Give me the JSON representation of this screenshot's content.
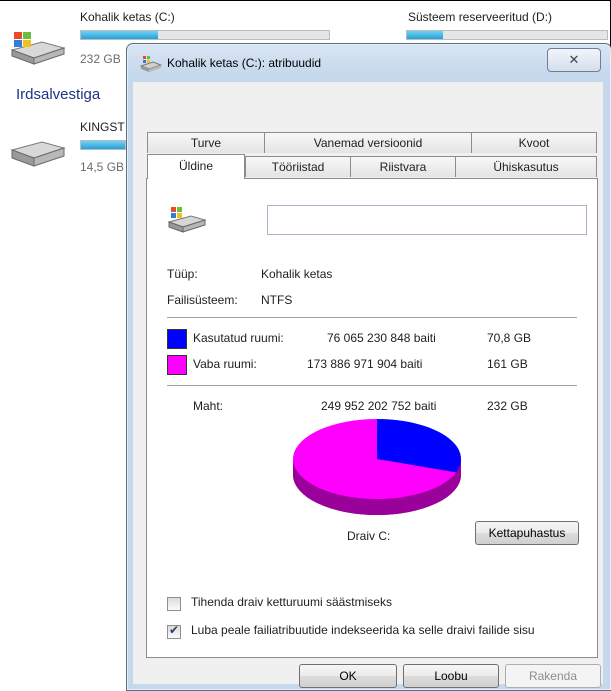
{
  "explorer": {
    "drives": [
      {
        "name": "Kohalik ketas (C:)",
        "size": "232 GB"
      },
      {
        "name": "Süsteem reserveeritud (D:)",
        "size": ""
      },
      {
        "name": "KINGST",
        "size": "14,5 GB"
      }
    ],
    "group_heading": "Irdsalvestiga"
  },
  "dialog": {
    "title": "Kohalik ketas (C:): atribuudid",
    "close_glyph": "✕",
    "tabs_row1": [
      "Turve",
      "Vanemad versioonid",
      "Kvoot"
    ],
    "tabs_row2": [
      "Üldine",
      "Tööriistad",
      "Riistvara",
      "Ühiskasutus"
    ],
    "active_tab": "Üldine",
    "drive_name_value": "",
    "type_label": "Tüüp:",
    "type_value": "Kohalik ketas",
    "fs_label": "Failisüsteem:",
    "fs_value": "NTFS",
    "used": {
      "label": "Kasutatud ruumi:",
      "bytes": "76 065 230 848 baiti",
      "size": "70,8 GB",
      "color": "#0000ff"
    },
    "free": {
      "label": "Vaba ruumi:",
      "bytes": "173 886 971 904 baiti",
      "size": "161 GB",
      "color": "#ff00ff"
    },
    "capacity": {
      "label": "Maht:",
      "bytes": "249 952 202 752 baiti",
      "size": "232 GB"
    },
    "used_fraction": 0.304,
    "drive_label": "Draiv C:",
    "cleanup_button": "Kettapuhastus",
    "compress_label": "Tihenda draiv ketturuumi säästmiseks",
    "compress_checked": false,
    "index_label": "Luba peale failiatribuutide indekseerida ka selle draivi failide sisu",
    "index_checked": true,
    "ok_button": "OK",
    "cancel_button": "Loobu",
    "apply_button": "Rakenda"
  }
}
